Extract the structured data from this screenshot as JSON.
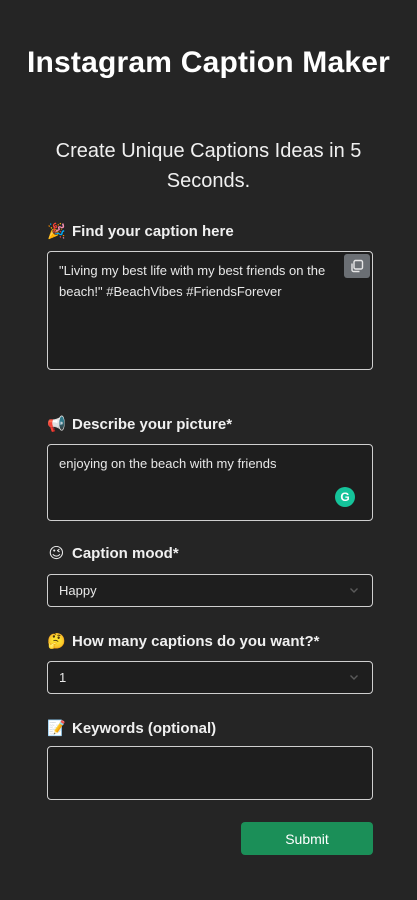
{
  "header": {
    "title": "Instagram Caption Maker",
    "subtitle": "Create Unique Captions Ideas in 5 Seconds."
  },
  "result": {
    "emoji": "🎉",
    "label": "Find your caption here",
    "text": "\"Living my best life with my best friends on the beach!\" #BeachVibes #FriendsForever",
    "copy_icon": "copy-icon"
  },
  "describe": {
    "emoji": "📢",
    "label": "Describe your picture*",
    "value": "enjoying on the beach with my friends",
    "grammarly_icon": "grammarly-icon",
    "grammarly_glyph": "G"
  },
  "mood": {
    "emoji": "😉",
    "label": "Caption mood*",
    "value": "Happy"
  },
  "count": {
    "emoji": "🤔",
    "label": "How many captions do you want?*",
    "value": "1"
  },
  "keywords": {
    "emoji": "📝",
    "label": "Keywords (optional)",
    "value": ""
  },
  "actions": {
    "submit_label": "Submit"
  },
  "colors": {
    "background": "#252525",
    "submit": "#1b8f58",
    "grammarly": "#15c39a"
  }
}
